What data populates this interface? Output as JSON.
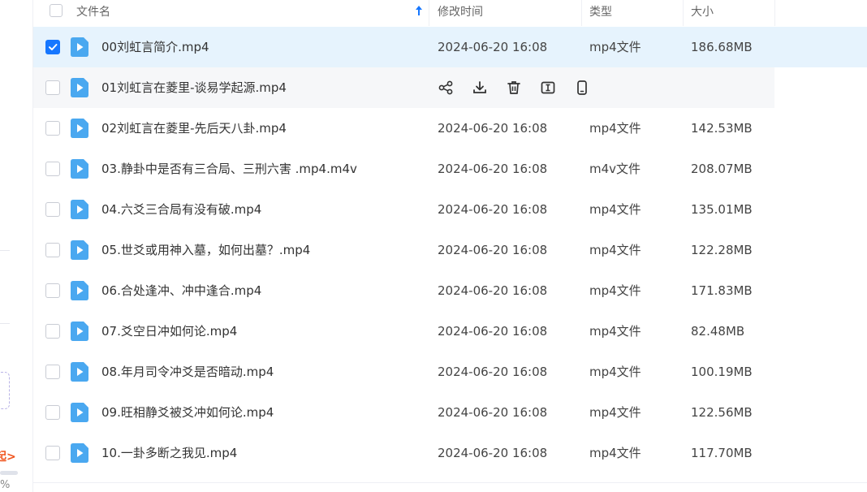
{
  "header": {
    "name_label": "文件名",
    "date_label": "修改时间",
    "type_label": "类型",
    "size_label": "大小"
  },
  "sidebar": {
    "partial_text": "起>",
    "partial_pct": "%"
  },
  "colors": {
    "accent": "#1677ff",
    "selected_row": "#e6f3fd",
    "hover_row": "#f6f7f9",
    "file_icon": "#4aa8f0"
  },
  "rows": [
    {
      "name": "00刘虹言简介.mp4",
      "date": "2024-06-20 16:08",
      "type": "mp4文件",
      "size": "186.68MB",
      "checked": true
    },
    {
      "name": "01刘虹言在菱里-谈易学起源.mp4",
      "date": "",
      "type": "",
      "size": "",
      "hover": true
    },
    {
      "name": "02刘虹言在菱里-先后天八卦.mp4",
      "date": "2024-06-20 16:08",
      "type": "mp4文件",
      "size": "142.53MB"
    },
    {
      "name": "03.静卦中是否有三合局、三刑六害 .mp4.m4v",
      "date": "2024-06-20 16:08",
      "type": "m4v文件",
      "size": "208.07MB"
    },
    {
      "name": "04.六爻三合局有没有破.mp4",
      "date": "2024-06-20 16:08",
      "type": "mp4文件",
      "size": "135.01MB"
    },
    {
      "name": "05.世爻或用神入墓，如何出墓？.mp4",
      "date": "2024-06-20 16:08",
      "type": "mp4文件",
      "size": "122.28MB"
    },
    {
      "name": "06.合处逢冲、冲中逢合.mp4",
      "date": "2024-06-20 16:08",
      "type": "mp4文件",
      "size": "171.83MB"
    },
    {
      "name": "07.爻空日冲如何论.mp4",
      "date": "2024-06-20 16:08",
      "type": "mp4文件",
      "size": "82.48MB"
    },
    {
      "name": "08.年月司令冲爻是否暗动.mp4",
      "date": "2024-06-20 16:08",
      "type": "mp4文件",
      "size": "100.19MB"
    },
    {
      "name": "09.旺相静爻被爻冲如何论.mp4",
      "date": "2024-06-20 16:08",
      "type": "mp4文件",
      "size": "122.56MB"
    },
    {
      "name": "10.一卦多断之我见.mp4",
      "date": "2024-06-20 16:08",
      "type": "mp4文件",
      "size": "117.70MB"
    }
  ],
  "row_actions": [
    "share-icon",
    "download-icon",
    "delete-icon",
    "rename-icon",
    "phone-icon"
  ]
}
